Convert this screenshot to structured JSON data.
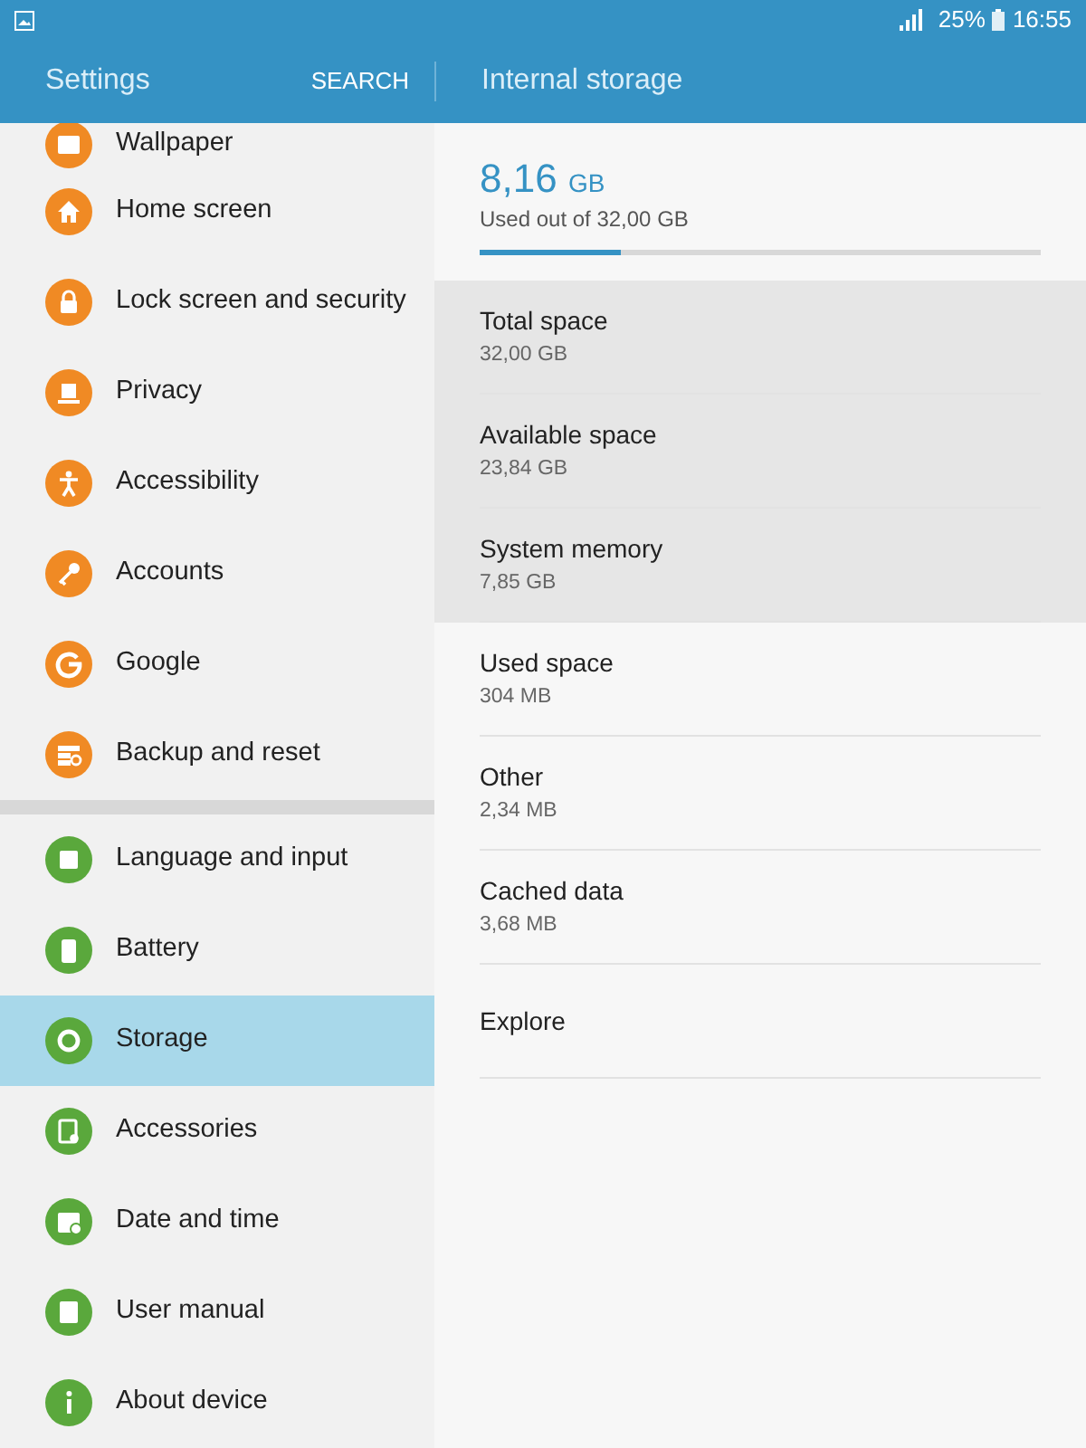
{
  "status_bar": {
    "battery": "25%",
    "time": "16:55"
  },
  "app_bar": {
    "title": "Settings",
    "search": "SEARCH",
    "detail_title": "Internal storage"
  },
  "sidebar": {
    "groups": [
      {
        "items": [
          {
            "label": "Wallpaper",
            "color": "#f08a24",
            "selected": false
          },
          {
            "label": "Home screen",
            "color": "#f08a24",
            "selected": false
          },
          {
            "label": "Lock screen and security",
            "color": "#f08a24",
            "selected": false
          },
          {
            "label": "Privacy",
            "color": "#f08a24",
            "selected": false
          },
          {
            "label": "Accessibility",
            "color": "#f08a24",
            "selected": false
          },
          {
            "label": "Accounts",
            "color": "#f08a24",
            "selected": false
          },
          {
            "label": "Google",
            "color": "#f08a24",
            "selected": false
          },
          {
            "label": "Backup and reset",
            "color": "#f08a24",
            "selected": false
          }
        ]
      },
      {
        "items": [
          {
            "label": "Language and input",
            "color": "#5aa83c",
            "selected": false
          },
          {
            "label": "Battery",
            "color": "#5aa83c",
            "selected": false
          },
          {
            "label": "Storage",
            "color": "#5aa83c",
            "selected": true
          },
          {
            "label": "Accessories",
            "color": "#5aa83c",
            "selected": false
          },
          {
            "label": "Date and time",
            "color": "#5aa83c",
            "selected": false
          },
          {
            "label": "User manual",
            "color": "#5aa83c",
            "selected": false
          },
          {
            "label": "About device",
            "color": "#5aa83c",
            "selected": false
          }
        ]
      }
    ]
  },
  "storage": {
    "used": "8,16",
    "unit": "GB",
    "caption": "Used out of 32,00 GB",
    "level": 0.25,
    "rows": [
      {
        "title": "Total space",
        "value": "32,00 GB",
        "shaded": true
      },
      {
        "title": "Available space",
        "value": "23,84 GB",
        "shaded": true
      },
      {
        "title": "System memory",
        "value": "7,85 GB",
        "shaded": true
      },
      {
        "title": "Used space",
        "value": "304 MB",
        "shaded": false
      },
      {
        "title": "Other",
        "value": "2,34 MB",
        "shaded": false
      },
      {
        "title": "Cached data",
        "value": "3,68 MB",
        "shaded": false
      },
      {
        "title": "Explore",
        "shaded": false
      }
    ]
  }
}
